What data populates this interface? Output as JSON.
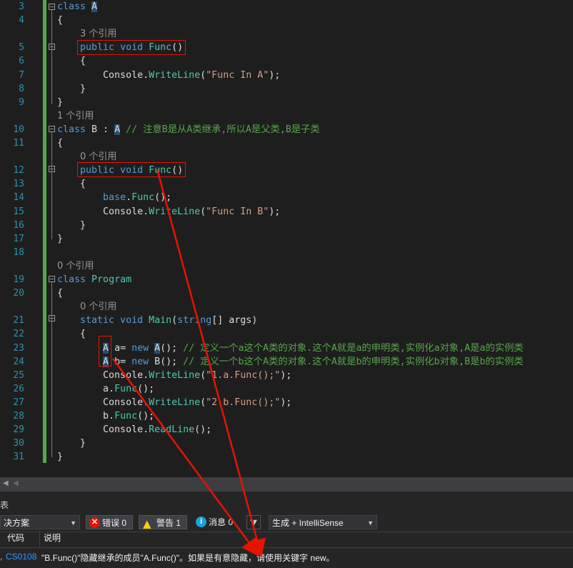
{
  "code_lines": [
    {
      "num": "3",
      "parts": [
        [
          "kw",
          "class"
        ],
        [
          "t",
          " "
        ],
        [
          "hl",
          "A"
        ]
      ]
    },
    {
      "num": "4",
      "parts": [
        [
          "t",
          "{"
        ]
      ]
    },
    {
      "num": "",
      "lens": "3 个引用",
      "indent": 2
    },
    {
      "num": "5",
      "parts": [
        [
          "t",
          "    "
        ],
        [
          "kw",
          "public"
        ],
        [
          "t",
          " "
        ],
        [
          "kw",
          "void"
        ],
        [
          "t",
          " "
        ],
        [
          "fn",
          "Func"
        ],
        [
          "t",
          "()"
        ]
      ]
    },
    {
      "num": "6",
      "parts": [
        [
          "t",
          "    {"
        ]
      ]
    },
    {
      "num": "7",
      "parts": [
        [
          "t",
          "        Console."
        ],
        [
          "fn",
          "WriteLine"
        ],
        [
          "t",
          "("
        ],
        [
          "st",
          "\"Func In A\""
        ],
        [
          "t",
          ");"
        ]
      ]
    },
    {
      "num": "8",
      "parts": [
        [
          "t",
          "    }"
        ]
      ]
    },
    {
      "num": "9",
      "parts": [
        [
          "t",
          "}"
        ]
      ]
    },
    {
      "num": "",
      "lens": "1 个引用",
      "indent": 0
    },
    {
      "num": "10",
      "parts": [
        [
          "kw",
          "class"
        ],
        [
          "t",
          " B : "
        ],
        [
          "hl",
          "A"
        ],
        [
          "t",
          " "
        ],
        [
          "cm",
          "// 注意B是从A类继承,所以A是父类,B是子类"
        ]
      ]
    },
    {
      "num": "11",
      "parts": [
        [
          "t",
          "{"
        ]
      ]
    },
    {
      "num": "",
      "lens": "0 个引用",
      "indent": 2
    },
    {
      "num": "12",
      "parts": [
        [
          "t",
          "    "
        ],
        [
          "kw",
          "public"
        ],
        [
          "t",
          " "
        ],
        [
          "kw",
          "void"
        ],
        [
          "t",
          " "
        ],
        [
          "fn",
          "Func"
        ],
        [
          "t",
          "()"
        ]
      ]
    },
    {
      "num": "13",
      "parts": [
        [
          "t",
          "    {"
        ]
      ]
    },
    {
      "num": "14",
      "parts": [
        [
          "t",
          "        "
        ],
        [
          "kw",
          "base"
        ],
        [
          "t",
          "."
        ],
        [
          "fn",
          "Func"
        ],
        [
          "t",
          "();"
        ]
      ]
    },
    {
      "num": "15",
      "parts": [
        [
          "t",
          "        Console."
        ],
        [
          "fn",
          "WriteLine"
        ],
        [
          "t",
          "("
        ],
        [
          "st",
          "\"Func In B\""
        ],
        [
          "t",
          ");"
        ]
      ]
    },
    {
      "num": "16",
      "parts": [
        [
          "t",
          "    }"
        ]
      ]
    },
    {
      "num": "17",
      "parts": [
        [
          "t",
          "}"
        ]
      ]
    },
    {
      "num": "18",
      "parts": []
    },
    {
      "num": "",
      "lens": "0 个引用",
      "indent": 0
    },
    {
      "num": "19",
      "parts": [
        [
          "kw",
          "class"
        ],
        [
          "t",
          " "
        ],
        [
          "cls",
          "Program"
        ]
      ]
    },
    {
      "num": "20",
      "parts": [
        [
          "t",
          "{"
        ]
      ]
    },
    {
      "num": "",
      "lens": "0 个引用",
      "indent": 2
    },
    {
      "num": "21",
      "parts": [
        [
          "t",
          "    "
        ],
        [
          "kw",
          "static"
        ],
        [
          "t",
          " "
        ],
        [
          "kw",
          "void"
        ],
        [
          "t",
          " "
        ],
        [
          "fn",
          "Main"
        ],
        [
          "t",
          "("
        ],
        [
          "kw",
          "string"
        ],
        [
          "t",
          "[] args)"
        ]
      ]
    },
    {
      "num": "22",
      "parts": [
        [
          "t",
          "    {"
        ]
      ]
    },
    {
      "num": "23",
      "parts": [
        [
          "t",
          "        "
        ],
        [
          "hl",
          "A"
        ],
        [
          "t",
          " a= "
        ],
        [
          "kw",
          "new"
        ],
        [
          "t",
          " "
        ],
        [
          "hl",
          "A"
        ],
        [
          "t",
          "(); "
        ],
        [
          "cm",
          "// 定义一个a这个A类的对象.这个A就是a的申明类,实例化a对象,A是a的实例类"
        ]
      ]
    },
    {
      "num": "24",
      "parts": [
        [
          "t",
          "        "
        ],
        [
          "hl",
          "A"
        ],
        [
          "t",
          " b= "
        ],
        [
          "kw",
          "new"
        ],
        [
          "t",
          " B(); "
        ],
        [
          "cm",
          "// 定义一个b这个A类的对象.这个A就是b的申明类,实例化b对象,B是b的实例类"
        ]
      ]
    },
    {
      "num": "25",
      "parts": [
        [
          "t",
          "        Console."
        ],
        [
          "fn",
          "WriteLine"
        ],
        [
          "t",
          "("
        ],
        [
          "st",
          "\"1.a.Func();\""
        ],
        [
          "t",
          ");"
        ]
      ]
    },
    {
      "num": "26",
      "parts": [
        [
          "t",
          "        a."
        ],
        [
          "fn",
          "Func"
        ],
        [
          "t",
          "();"
        ]
      ]
    },
    {
      "num": "27",
      "parts": [
        [
          "t",
          "        Console."
        ],
        [
          "fn",
          "WriteLine"
        ],
        [
          "t",
          "("
        ],
        [
          "st",
          "\"2.b.Func();\""
        ],
        [
          "t",
          ");"
        ]
      ]
    },
    {
      "num": "28",
      "parts": [
        [
          "t",
          "        b."
        ],
        [
          "fn",
          "Func"
        ],
        [
          "t",
          "();"
        ]
      ]
    },
    {
      "num": "29",
      "parts": [
        [
          "t",
          "        Console."
        ],
        [
          "fn",
          "ReadLine"
        ],
        [
          "t",
          "();"
        ]
      ]
    },
    {
      "num": "30",
      "parts": [
        [
          "t",
          "    }"
        ]
      ]
    },
    {
      "num": "31",
      "parts": [
        [
          "t",
          "}"
        ]
      ]
    }
  ],
  "error_list": {
    "panel_title": "表",
    "scope_label": "决方案",
    "errors_label": "错误 0",
    "warnings_label": "警告 1",
    "messages_label": "消息 0",
    "build_filter_label": "生成 + IntelliSense",
    "col_code": "代码",
    "col_desc": "说明",
    "row_code": "CS0108",
    "row_desc": "\"B.Func()\"隐藏继承的成员\"A.Func()\"。如果是有意隐藏，请使用关键字 new。",
    "colors": {
      "error": "#e51400",
      "warning": "#ffcc00",
      "info": "#1ba1e2",
      "link": "#3794ff"
    }
  },
  "icons": [
    "error-icon",
    "warning-icon",
    "info-icon",
    "filter-icon",
    "dropdown-arrow-icon"
  ],
  "annotation_color": "#e51400"
}
